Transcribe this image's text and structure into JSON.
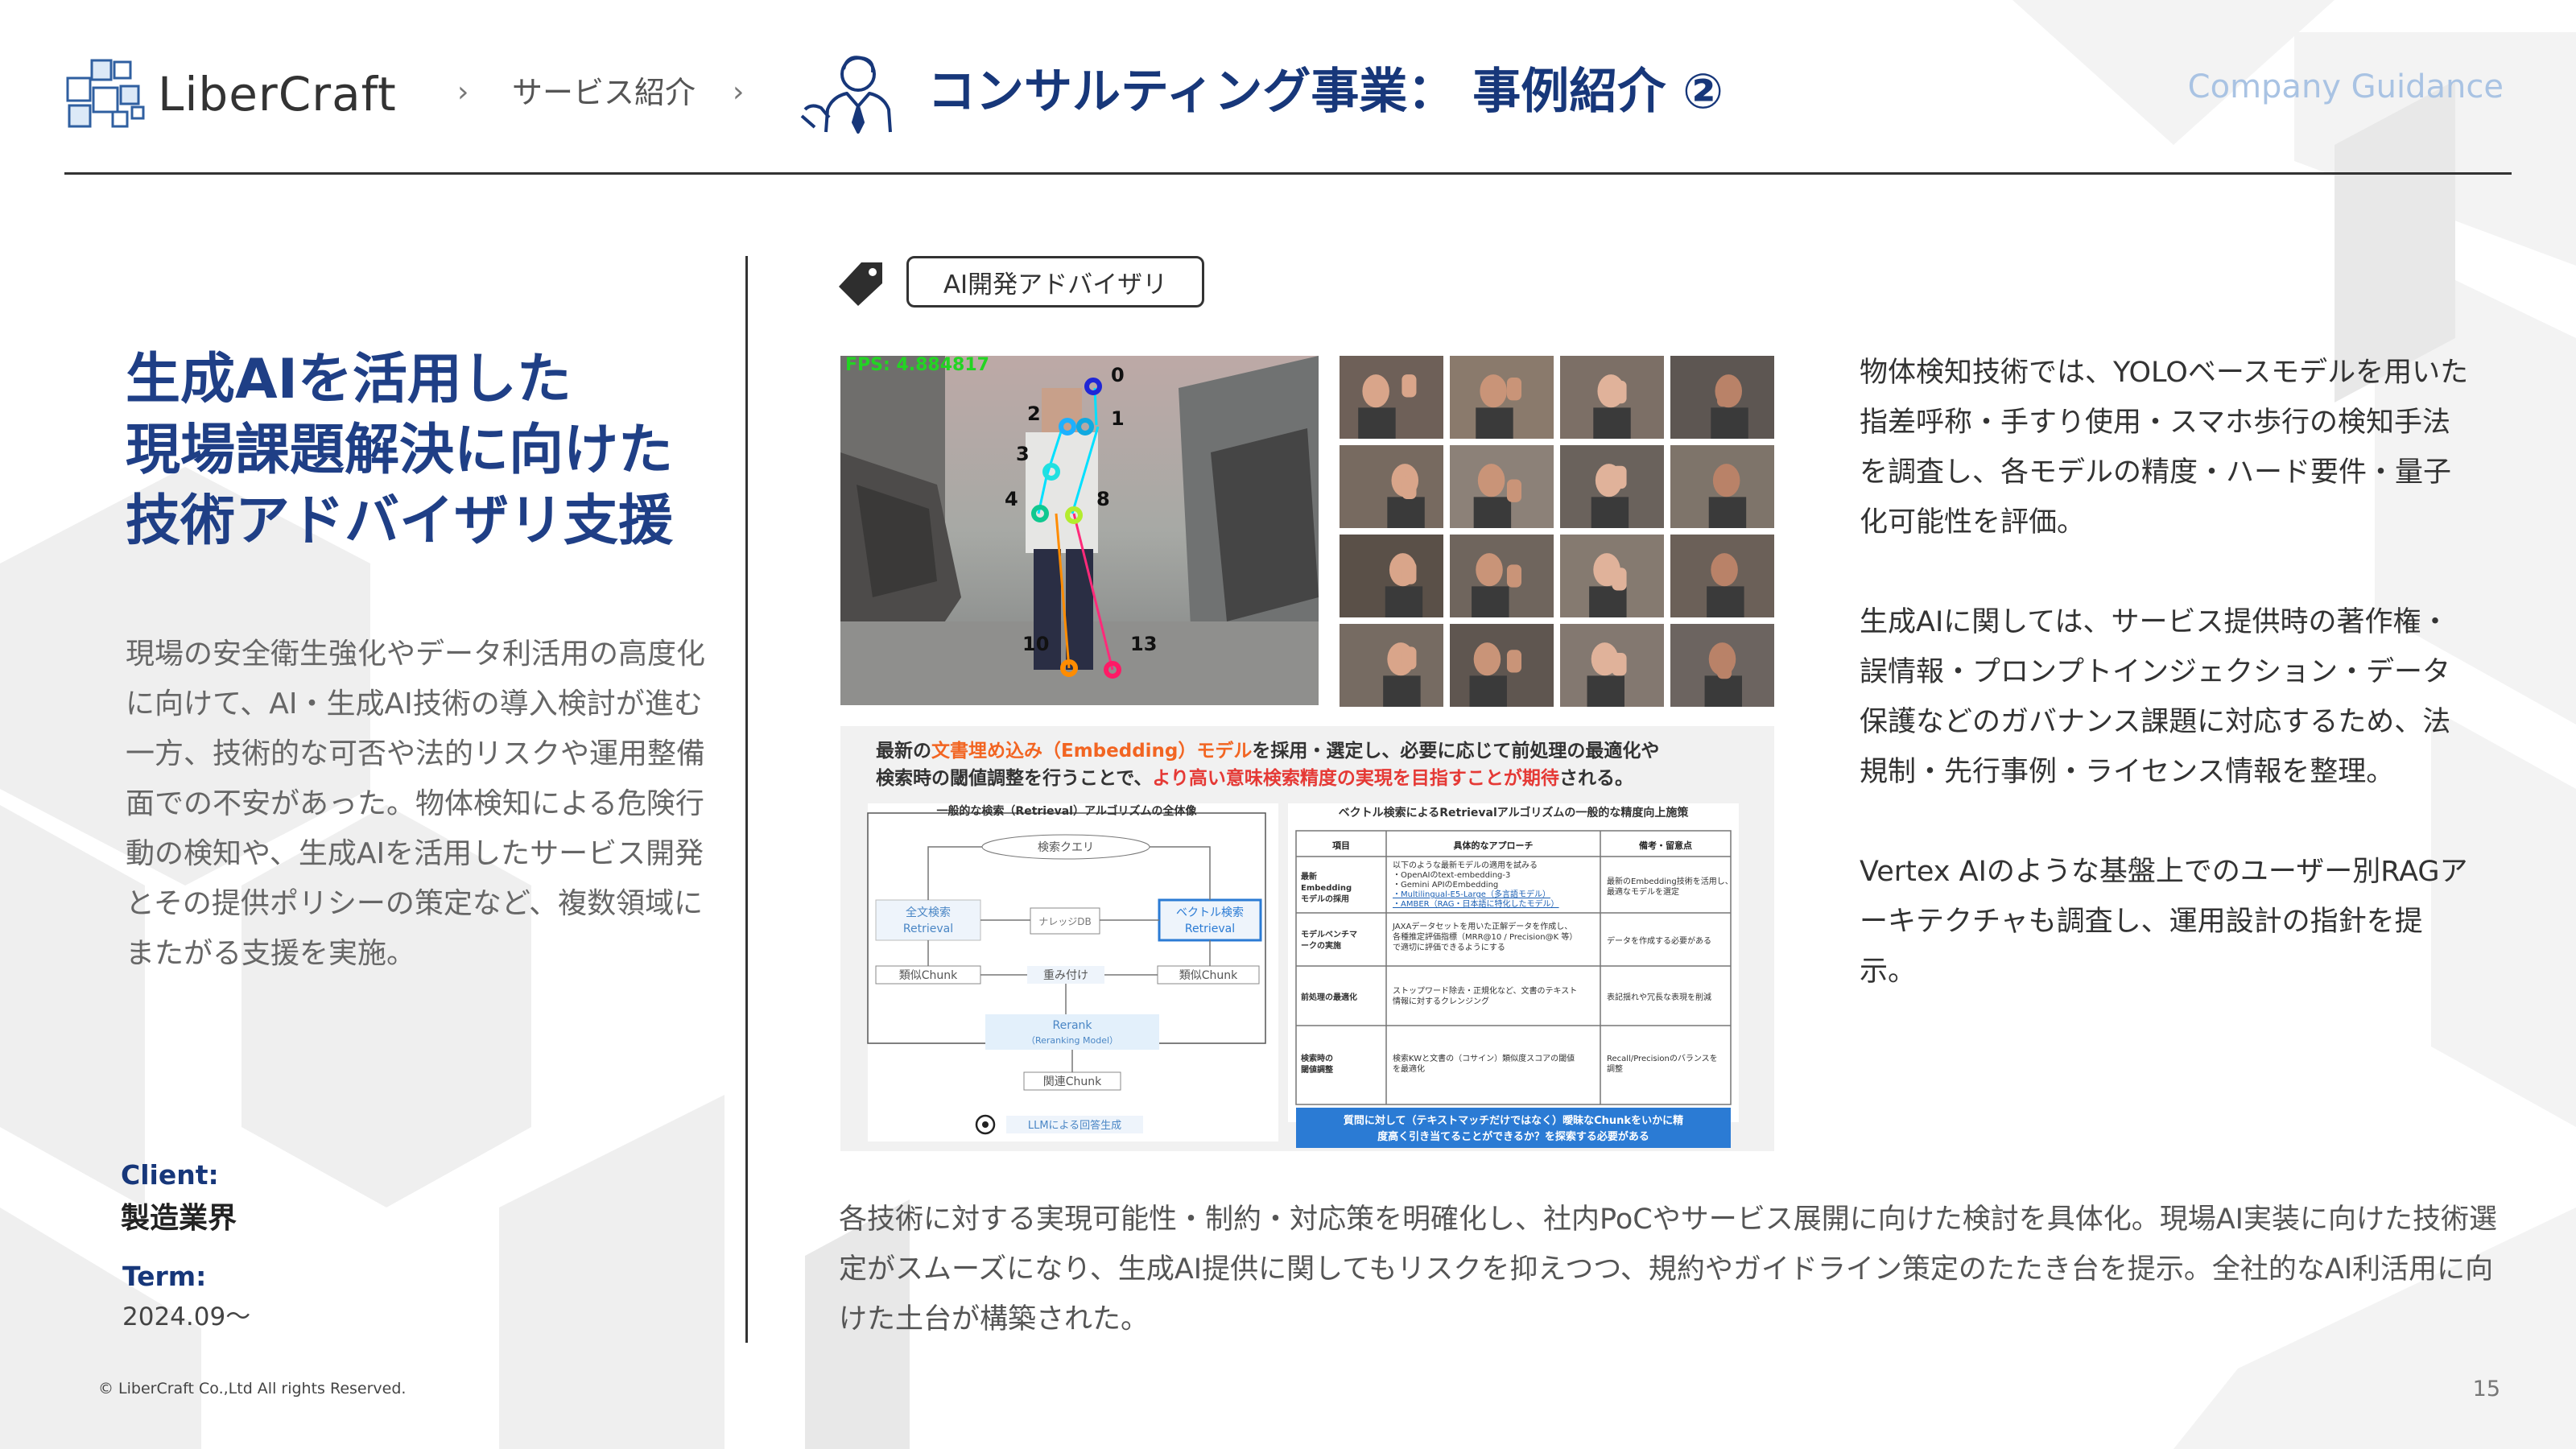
{
  "header": {
    "logo_text": "LiberCraft",
    "breadcrumb": [
      "サービス紹介"
    ],
    "title": "コンサルティング事業： 事例紹介 ②",
    "guidance": "Company Guidance"
  },
  "left": {
    "headline_lines": [
      "生成AIを活用した",
      "現場課題解決に向けた",
      "技術アドバイザリ支援"
    ],
    "lead": "現場の安全衛生強化やデータ利活用の高度化に向けて、AI・生成AI技術の導入検討が進む一方、技術的な可否や法的リスクや運用整備面での不安があった。物体検知による危険行動の検知や、生成AIを活用したサービス開発とその提供ポリシーの策定など、複数領域にまたがる支援を実施。",
    "client_label": "Client:",
    "client_value": "製造業界",
    "term_label": "Term:",
    "term_value": "2024.09〜"
  },
  "tag": {
    "label": "AI開発アドバイザリ",
    "icon": "tag-icon"
  },
  "pose": {
    "fps": "FPS: 4.884817",
    "keypoints": [
      "0",
      "1",
      "2",
      "3",
      "4",
      "8",
      "10",
      "13"
    ]
  },
  "diagram": {
    "caption_line1_a": "最新の",
    "caption_line1_b": "文書埋め込み（Embedding）モデル",
    "caption_line1_c": "を採用・選定し、必要に応じて前処理の最適化や",
    "caption_line2_a": "検索時の閾値調整を行うことで、",
    "caption_line2_b": "より高い意味検索精度の実現を目指すことが期待",
    "caption_line2_c": "される。",
    "flow_title": "一般的な検索（Retrieval）アルゴリズムの全体像",
    "query": "検索クエリ",
    "fulltext_1": "全文検索",
    "fulltext_2": "Retrieval",
    "vector_1": "ベクトル検索",
    "vector_2": "Retrieval",
    "knowledge_db": "ナレッジDB",
    "similar_chunk": "類似Chunk",
    "weighting": "重み付け",
    "rerank_1": "Rerank",
    "rerank_2": "（Reranking Model）",
    "related_chunk": "関連Chunk",
    "llm_answer": "LLMによる回答生成",
    "table_title": "ベクトル検索によるRetrievalアルゴリズムの一般的な精度向上施策",
    "table_headers": [
      "項目",
      "具体的なアプローチ",
      "備考・留意点"
    ],
    "rows": [
      {
        "item": [
          "最新",
          "Embedding",
          "モデルの採用"
        ],
        "approach": [
          "以下のような最新モデルの適用を試みる",
          "・OpenAIのtext-embedding-3",
          "・Gemini APIのEmbedding",
          "・Multilingual-E5-Large（多言語モデル）",
          "・AMBER（RAG・日本語に特化したモデル）"
        ],
        "note": [
          "最新のEmbedding技術を活用し、",
          "最適なモデルを選定"
        ]
      },
      {
        "item": [
          "モデルベンチマ",
          "ークの実施"
        ],
        "approach": [
          "JAXAデータセットを用いた正解データを作成し、",
          "各種推定評価指標（MRR@10 / Precision@K 等）",
          "で適切に評価できるようにする"
        ],
        "note": [
          "データを作成する必要がある"
        ]
      },
      {
        "item": [
          "前処理の最適化"
        ],
        "approach": [
          "ストップワード除去・正規化など、文書のテキスト",
          "情報に対するクレンジング"
        ],
        "note": [
          "表記揺れや冗長な表現を削減"
        ]
      },
      {
        "item": [
          "検索時の",
          "閾値調整"
        ],
        "approach": [
          "検索KWと文書の（コサイン）類似度スコアの閾値",
          "を最適化"
        ],
        "note": [
          "Recall/Precisionのバランスを",
          "調整"
        ]
      }
    ],
    "footer_line1": "質問に対して（テキストマッチだけではなく）曖昧なChunkをいかに精",
    "footer_line2": "度高く引き当てることができるか？を探索する必要がある"
  },
  "right": {
    "para1": "物体検知技術では、YOLOベースモデルを用いた指差呼称・手すり使用・スマホ歩行の検知手法を調査し、各モデルの精度・ハード要件・量子化可能性を評価。",
    "para2": "生成AIに関しては、サービス提供時の著作権・誤情報・プロンプトインジェクション・データ保護などのガバナンス課題に対応するため、法規制・先行事例・ライセンス情報を整理。",
    "para3": "Vertex AIのような基盤上でのユーザー別RAGアーキテクチャも調査し、運用設計の指針を提示。"
  },
  "bottom": {
    "text": "各技術に対する実現可能性・制約・対応策を明確化し、社内PoCやサービス展開に向けた検討を具体化。現場AI実装に向けた技術選定がスムーズになり、生成AI提供に関してもリスクを抑えつつ、規約やガイドライン策定のたたき台を提示。全社的なAI利活用に向けた土台が構築された。"
  },
  "footer": {
    "copyright": "© LiberCraft Co.,Ltd All rights Reserved.",
    "page_number": "15"
  },
  "colors": {
    "title": "#17377a",
    "headline": "#1f3f86",
    "guidance": "#a9c3e3",
    "accent_orange": "#f26522",
    "accent_red": "#e53935"
  }
}
